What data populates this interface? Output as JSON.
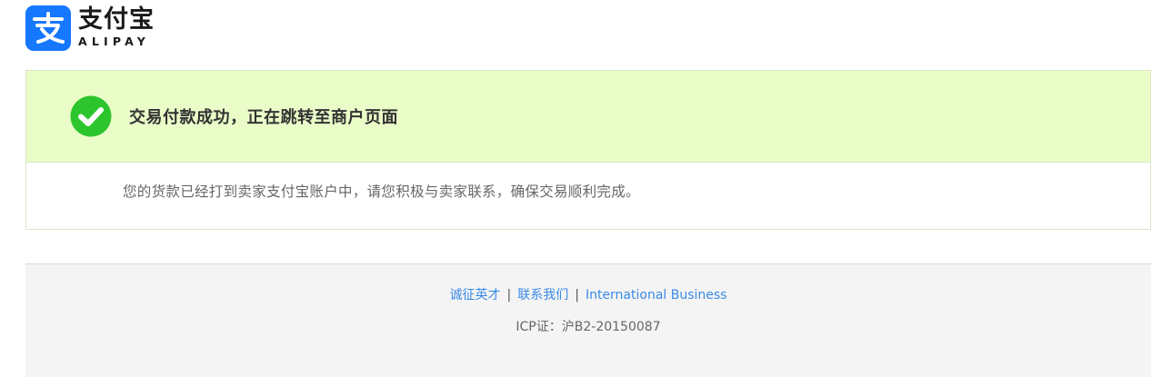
{
  "brand": {
    "name_cn": "支付宝",
    "name_en": "ALIPAY",
    "logo_icon": "alipay-logo-icon",
    "logo_color": "#1677ff"
  },
  "result": {
    "status_icon": "check-circle-icon",
    "status_color": "#2dc52d",
    "title": "交易付款成功，正在跳转至商户页面",
    "description": "您的货款已经打到卖家支付宝账户中，请您积极与卖家联系，确保交易顺利完成。",
    "header_bg": "#eafdc8"
  },
  "footer": {
    "links": [
      {
        "label": "诚征英才"
      },
      {
        "label": "联系我们"
      },
      {
        "label": "International Business"
      }
    ],
    "separator": "|",
    "icp": "ICP证：沪B2-20150087",
    "link_color": "#3a8ae6"
  }
}
